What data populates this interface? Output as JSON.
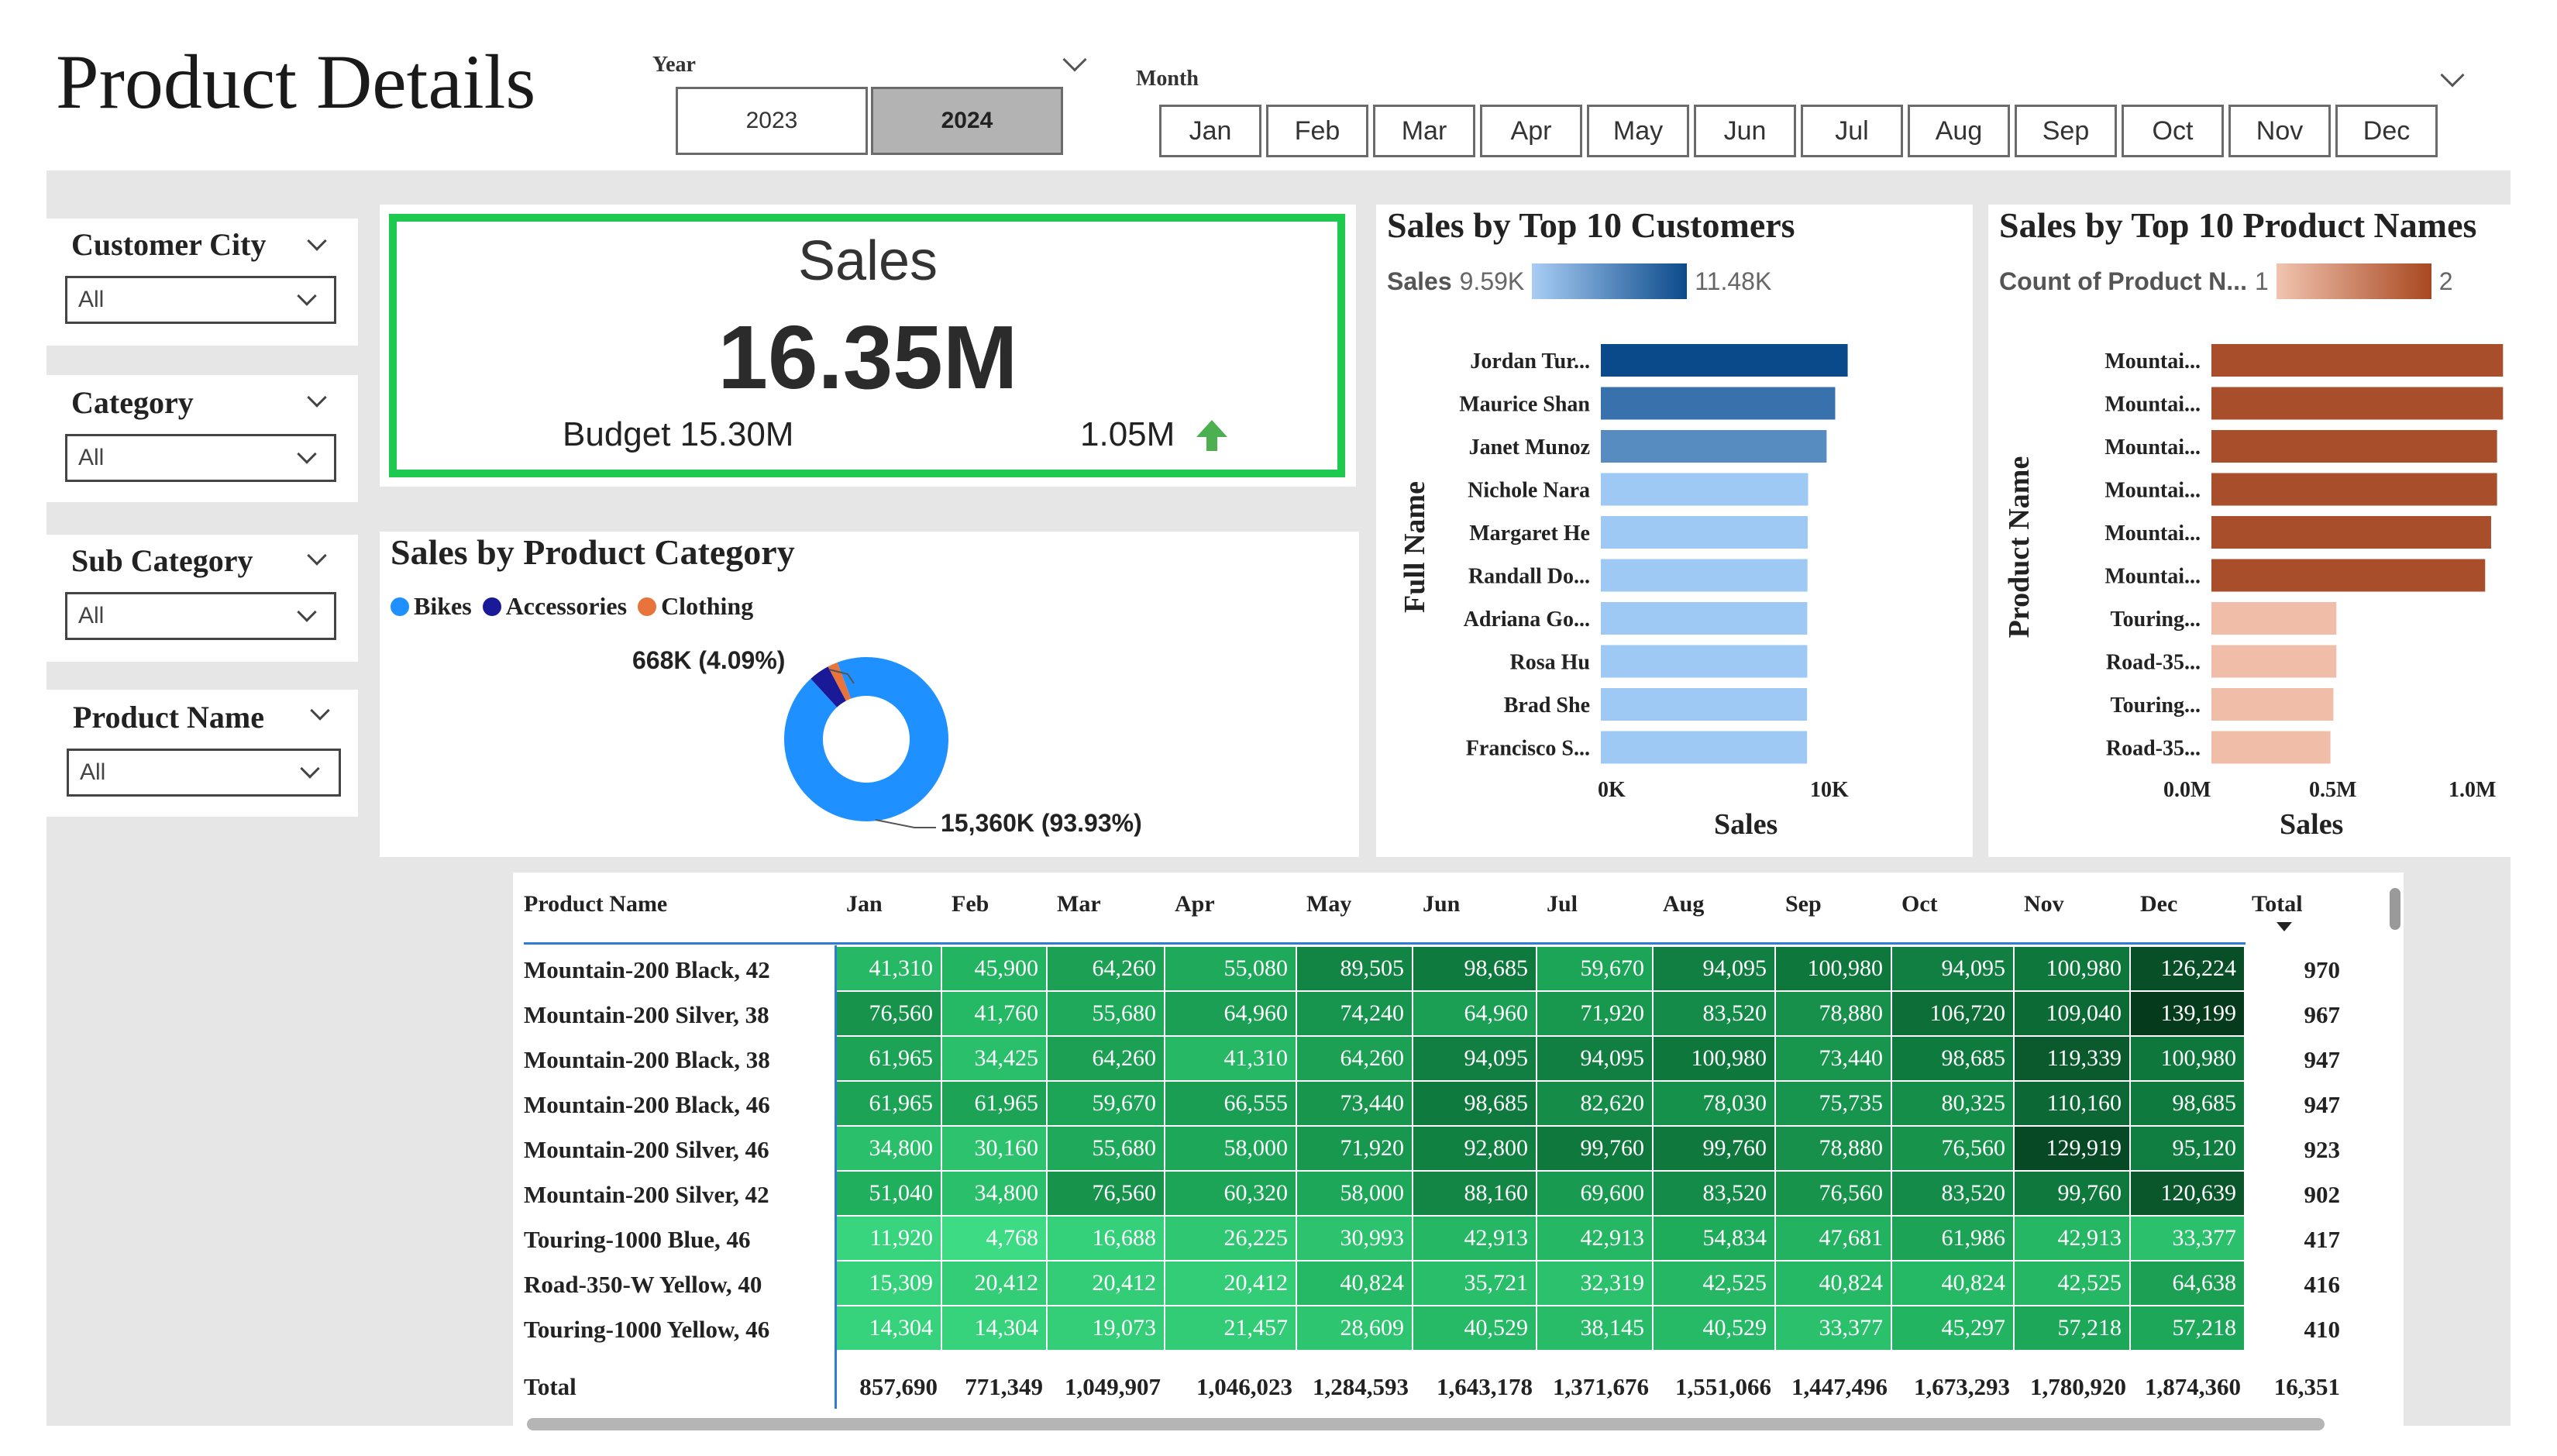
{
  "header": {
    "title": "Product Details",
    "year_label": "Year",
    "years": [
      "2023",
      "2024"
    ],
    "selected_year": "2024",
    "month_label": "Month",
    "months": [
      "Jan",
      "Feb",
      "Mar",
      "Apr",
      "May",
      "Jun",
      "Jul",
      "Aug",
      "Sep",
      "Oct",
      "Nov",
      "Dec"
    ]
  },
  "slicers": [
    {
      "title": "Customer City",
      "value": "All"
    },
    {
      "title": "Category",
      "value": "All"
    },
    {
      "title": "Sub Category",
      "value": "All"
    },
    {
      "title": "Product Name",
      "value": "All"
    }
  ],
  "kpi": {
    "title": "Sales",
    "value": "16.35M",
    "budget": "Budget 15.30M",
    "variance": "1.05M",
    "variance_direction": "up",
    "border_color": "#1ec950",
    "arrow_color": "#4caf50"
  },
  "category_chart": {
    "title": "Sales by Product Category",
    "legend": [
      {
        "name": "Bikes",
        "color": "#1e90ff"
      },
      {
        "name": "Accessories",
        "color": "#1a1a99"
      },
      {
        "name": "Clothing",
        "color": "#e8743b"
      }
    ],
    "label_small": "668K (4.09%)",
    "label_large": "15,360K (93.93%)"
  },
  "customers_chart": {
    "title": "Sales by Top 10 Customers",
    "legend_label": "Sales",
    "legend_min": "9.59K",
    "legend_max": "11.48K",
    "y_title": "Full Name",
    "x_title": "Sales",
    "x_ticks": [
      "0K",
      "10K"
    ]
  },
  "products_chart": {
    "title": "Sales by Top 10 Product Names",
    "legend_label": "Count of Product N...",
    "legend_min": "1",
    "legend_max": "2",
    "y_title": "Product Name",
    "x_title": "Sales",
    "x_ticks": [
      "0.0M",
      "0.5M",
      "1.0M"
    ]
  },
  "chart_data": [
    {
      "type": "pie",
      "title": "Sales by Product Category",
      "categories": [
        "Bikes",
        "Accessories",
        "Clothing"
      ],
      "values": [
        15360,
        668,
        324
      ],
      "units": "K"
    },
    {
      "type": "bar",
      "orientation": "horizontal",
      "title": "Sales by Top 10 Customers",
      "categories": [
        "Jordan Tur...",
        "Maurice Shan",
        "Janet Munoz",
        "Nichole Nara",
        "Margaret He",
        "Randall Do...",
        "Adriana Go...",
        "Rosa Hu",
        "Brad She",
        "Francisco S..."
      ],
      "values": [
        11480,
        10900,
        10500,
        9640,
        9620,
        9610,
        9600,
        9600,
        9590,
        9590
      ],
      "xlim": [
        0,
        12000
      ],
      "xlabel": "Sales",
      "ylabel": "Full Name"
    },
    {
      "type": "bar",
      "orientation": "horizontal",
      "title": "Sales by Top 10 Product Names",
      "categories": [
        "Mountai...",
        "Mountai...",
        "Mountai...",
        "Mountai...",
        "Mountai...",
        "Mountai...",
        "Touring...",
        "Road-35...",
        "Touring...",
        "Road-35..."
      ],
      "values": [
        0.98,
        0.98,
        0.96,
        0.96,
        0.94,
        0.92,
        0.42,
        0.42,
        0.41,
        0.4
      ],
      "counts": [
        2,
        2,
        2,
        2,
        2,
        2,
        1,
        1,
        1,
        1
      ],
      "xlim": [
        0,
        1.0
      ],
      "xlabel": "Sales",
      "ylabel": "Product Name"
    }
  ],
  "matrix": {
    "headers": [
      "Product Name",
      "Jan",
      "Feb",
      "Mar",
      "Apr",
      "May",
      "Jun",
      "Jul",
      "Aug",
      "Sep",
      "Oct",
      "Nov",
      "Dec",
      "Total"
    ],
    "rows": [
      {
        "name": "Mountain-200 Black, 42",
        "values": [
          41310,
          45900,
          64260,
          55080,
          89505,
          98685,
          59670,
          94095,
          100980,
          94095,
          100980,
          126224
        ],
        "display": [
          "41,310",
          "45,900",
          "64,260",
          "55,080",
          "89,505",
          "98,685",
          "59,670",
          "94,095",
          "100,980",
          "94,095",
          "100,980",
          "126,224"
        ],
        "total": "970"
      },
      {
        "name": "Mountain-200 Silver, 38",
        "values": [
          76560,
          41760,
          55680,
          64960,
          74240,
          64960,
          71920,
          83520,
          78880,
          106720,
          109040,
          139199
        ],
        "display": [
          "76,560",
          "41,760",
          "55,680",
          "64,960",
          "74,240",
          "64,960",
          "71,920",
          "83,520",
          "78,880",
          "106,720",
          "109,040",
          "139,199"
        ],
        "total": "967"
      },
      {
        "name": "Mountain-200 Black, 38",
        "values": [
          61965,
          34425,
          64260,
          41310,
          64260,
          94095,
          94095,
          100980,
          73440,
          98685,
          119339,
          100980
        ],
        "display": [
          "61,965",
          "34,425",
          "64,260",
          "41,310",
          "64,260",
          "94,095",
          "94,095",
          "100,980",
          "73,440",
          "98,685",
          "119,339",
          "100,980"
        ],
        "total": "947"
      },
      {
        "name": "Mountain-200 Black, 46",
        "values": [
          61965,
          61965,
          59670,
          66555,
          73440,
          98685,
          82620,
          78030,
          75735,
          80325,
          110160,
          98685
        ],
        "display": [
          "61,965",
          "61,965",
          "59,670",
          "66,555",
          "73,440",
          "98,685",
          "82,620",
          "78,030",
          "75,735",
          "80,325",
          "110,160",
          "98,685"
        ],
        "total": "947"
      },
      {
        "name": "Mountain-200 Silver, 46",
        "values": [
          34800,
          30160,
          55680,
          58000,
          71920,
          92800,
          99760,
          99760,
          78880,
          76560,
          129919,
          95120
        ],
        "display": [
          "34,800",
          "30,160",
          "55,680",
          "58,000",
          "71,920",
          "92,800",
          "99,760",
          "99,760",
          "78,880",
          "76,560",
          "129,919",
          "95,120"
        ],
        "total": "923"
      },
      {
        "name": "Mountain-200 Silver, 42",
        "values": [
          51040,
          34800,
          76560,
          60320,
          58000,
          88160,
          69600,
          83520,
          76560,
          83520,
          99760,
          120639
        ],
        "display": [
          "51,040",
          "34,800",
          "76,560",
          "60,320",
          "58,000",
          "88,160",
          "69,600",
          "83,520",
          "76,560",
          "83,520",
          "99,760",
          "120,639"
        ],
        "total": "902"
      },
      {
        "name": "Touring-1000 Blue, 46",
        "values": [
          11920,
          4768,
          16688,
          26225,
          30993,
          42913,
          42913,
          54834,
          47681,
          61986,
          42913,
          33377
        ],
        "display": [
          "11,920",
          "4,768",
          "16,688",
          "26,225",
          "30,993",
          "42,913",
          "42,913",
          "54,834",
          "47,681",
          "61,986",
          "42,913",
          "33,377"
        ],
        "total": "417"
      },
      {
        "name": "Road-350-W Yellow, 40",
        "values": [
          15309,
          20412,
          20412,
          20412,
          40824,
          35721,
          32319,
          42525,
          40824,
          40824,
          42525,
          64638
        ],
        "display": [
          "15,309",
          "20,412",
          "20,412",
          "20,412",
          "40,824",
          "35,721",
          "32,319",
          "42,525",
          "40,824",
          "40,824",
          "42,525",
          "64,638"
        ],
        "total": "416"
      },
      {
        "name": "Touring-1000 Yellow, 46",
        "values": [
          14304,
          14304,
          19073,
          21457,
          28609,
          40529,
          38145,
          40529,
          33377,
          45297,
          57218,
          57218
        ],
        "display": [
          "14,304",
          "14,304",
          "19,073",
          "21,457",
          "28,609",
          "40,529",
          "38,145",
          "40,529",
          "33,377",
          "45,297",
          "57,218",
          "57,218"
        ],
        "total": "410"
      }
    ],
    "totals_label": "Total",
    "totals": [
      "857,690",
      "771,349",
      "1,049,907",
      "1,046,023",
      "1,284,593",
      "1,643,178",
      "1,371,676",
      "1,551,066",
      "1,447,496",
      "1,673,293",
      "1,780,920",
      "1,874,360",
      "16,351"
    ]
  }
}
